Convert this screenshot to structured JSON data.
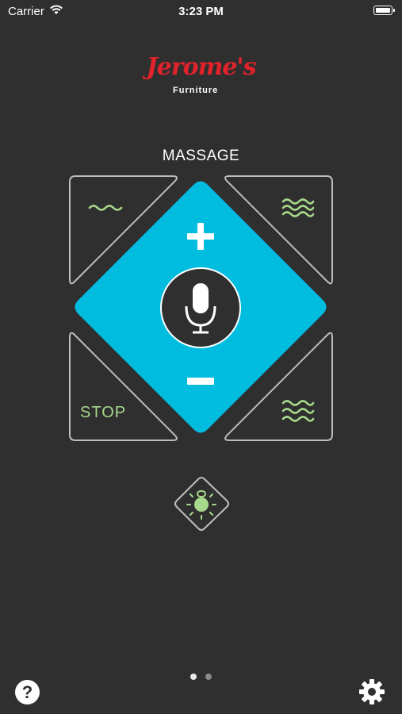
{
  "status_bar": {
    "carrier": "Carrier",
    "time": "3:23 PM"
  },
  "logo": {
    "name": "Jerome's",
    "sub": "Furniture"
  },
  "controls": {
    "title": "MASSAGE",
    "stop_label": "STOP",
    "plus_symbol": "+",
    "minus_symbol": "−"
  },
  "pager": {
    "total": 2,
    "active": 1
  },
  "footer": {
    "help_label": "?"
  },
  "colors": {
    "background": "#2f2f2f",
    "accent": "#00bde0",
    "green": "#a8d88b",
    "outline": "#bdbdbd"
  },
  "icons": [
    "wifi-icon",
    "battery-icon",
    "wave-low-icon",
    "wave-high-icon",
    "wave-pulse-icon",
    "microphone-icon",
    "plus-icon",
    "minus-icon",
    "light-icon",
    "gear-icon",
    "help-icon"
  ]
}
